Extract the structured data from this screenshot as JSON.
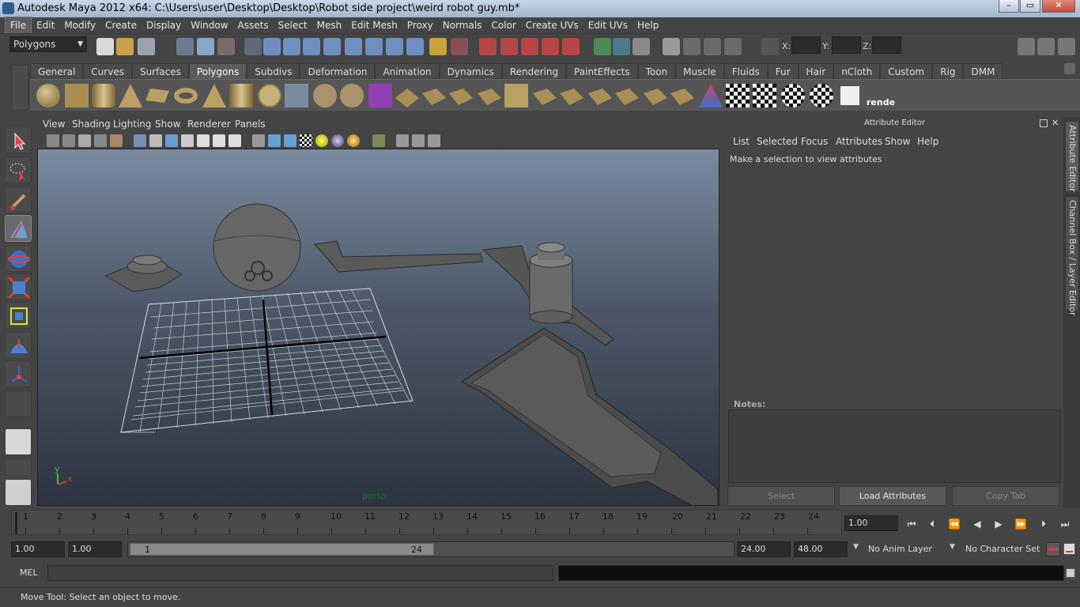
{
  "window": {
    "title": "Autodesk Maya 2012 x64: C:\\Users\\user\\Desktop\\Desktop\\Robot side project\\weird robot guy.mb*"
  },
  "menubar": {
    "items": [
      "File",
      "Edit",
      "Modify",
      "Create",
      "Display",
      "Window",
      "Assets",
      "Select",
      "Mesh",
      "Edit Mesh",
      "Proxy",
      "Normals",
      "Color",
      "Create UVs",
      "Edit UVs",
      "Help"
    ]
  },
  "statusline": {
    "menuset": "Polygons",
    "x_label": "X:",
    "y_label": "Y:",
    "z_label": "Z:"
  },
  "shelf": {
    "tabs": [
      "General",
      "Curves",
      "Surfaces",
      "Polygons",
      "Subdivs",
      "Deformation",
      "Animation",
      "Dynamics",
      "Rendering",
      "PaintEffects",
      "Toon",
      "Muscle",
      "Fluids",
      "Fur",
      "Hair",
      "nCloth",
      "Custom",
      "Rig",
      "DMM"
    ],
    "active_tab": "Polygons",
    "last_icon_label": "rende"
  },
  "panel": {
    "menus": [
      "View",
      "Shading",
      "Lighting",
      "Show",
      "Renderer",
      "Panels"
    ],
    "camera_label": "persp",
    "axis_x": "x",
    "axis_y": "y"
  },
  "attribute_editor": {
    "title": "Attribute Editor",
    "menus": [
      "List",
      "Selected",
      "Focus",
      "Attributes",
      "Show",
      "Help"
    ],
    "message": "Make a selection to view attributes",
    "notes_label": "Notes:",
    "buttons": {
      "select": "Select",
      "load": "Load Attributes",
      "copy": "Copy Tab"
    }
  },
  "side_tabs": {
    "attribute_editor": "Attribute Editor",
    "channel_box": "Channel Box / Layer Editor"
  },
  "timeline": {
    "ticks": [
      "1",
      "2",
      "3",
      "4",
      "5",
      "6",
      "7",
      "8",
      "9",
      "10",
      "11",
      "12",
      "13",
      "14",
      "15",
      "16",
      "17",
      "18",
      "19",
      "20",
      "21",
      "22",
      "23",
      "24"
    ],
    "current_frame": "1.00"
  },
  "range": {
    "start_time": "1.00",
    "playback_start": "1.00",
    "range_start": "1",
    "range_end": "24",
    "playback_end": "24.00",
    "end_time": "48.00",
    "anim_layer": "No Anim Layer",
    "character_set": "No Character Set"
  },
  "command": {
    "label": "MEL"
  },
  "help": {
    "text": "Move Tool: Select an object to move."
  }
}
